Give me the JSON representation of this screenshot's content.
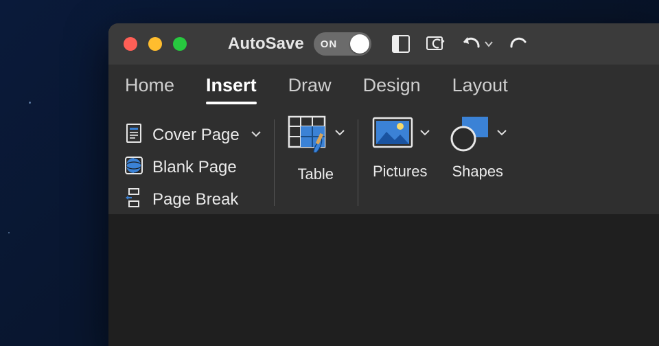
{
  "titlebar": {
    "autosave_label": "AutoSave",
    "autosave_state": "ON"
  },
  "tabs": {
    "home": "Home",
    "insert": "Insert",
    "draw": "Draw",
    "design": "Design",
    "layout": "Layout"
  },
  "active_tab": "insert",
  "ribbon": {
    "pages": {
      "cover_page": "Cover Page",
      "blank_page": "Blank Page",
      "page_break": "Page Break"
    },
    "table_label": "Table",
    "pictures_label": "Pictures",
    "shapes_label": "Shapes"
  },
  "icons": {
    "template": "template-icon",
    "sync": "sync-icon",
    "undo": "undo-icon",
    "redo": "redo-icon",
    "cover_page": "cover-page-icon",
    "blank_page": "blank-page-icon",
    "page_break": "page-break-icon",
    "table": "table-icon",
    "pictures": "pictures-icon",
    "shapes": "shapes-icon"
  },
  "colors": {
    "accent": "#3b82d6",
    "window_bg": "#2f2f2f",
    "titlebar_bg": "#3b3b3b"
  }
}
